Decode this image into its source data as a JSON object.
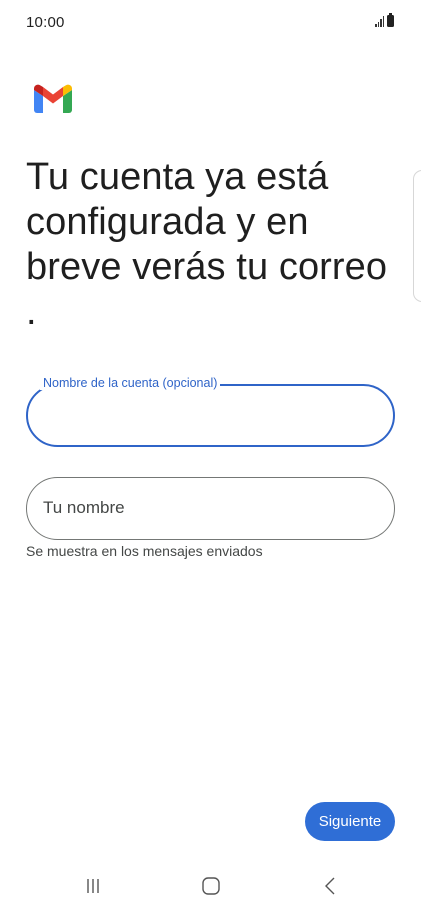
{
  "status_bar": {
    "time": "10:00",
    "icons": [
      "signal-icon",
      "battery-icon"
    ]
  },
  "logo": {
    "name": "gmail-logo",
    "colors": [
      "#4285F4",
      "#34A853",
      "#FBBC04",
      "#EA4335",
      "#C5221F"
    ]
  },
  "headline": "Tu cuenta ya está configurada y en breve verás tu correo .",
  "account_field": {
    "label": "Nombre de la cuenta (opcional)",
    "value": ""
  },
  "name_field": {
    "placeholder": "Tu nombre",
    "value": "",
    "helper": "Se muestra en los mensajes enviados"
  },
  "next_button": {
    "label": "Siguiente"
  },
  "nav_bar": {
    "items": [
      "recent-apps-icon",
      "home-icon",
      "back-icon"
    ]
  },
  "colors": {
    "accent": "#2f6ed6",
    "focus_border": "#2f64c8",
    "text": "#1f1f1f"
  }
}
